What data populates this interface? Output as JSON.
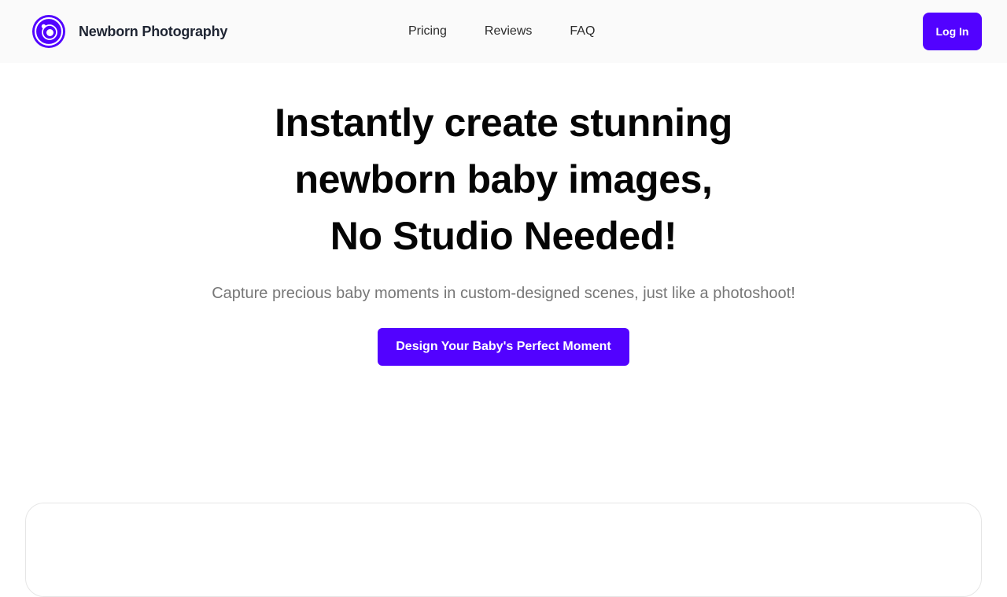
{
  "header": {
    "brand_name": "Newborn Photography",
    "logo_icon": "camera-lens-logo",
    "nav": [
      {
        "label": "Pricing"
      },
      {
        "label": "Reviews"
      },
      {
        "label": "FAQ"
      }
    ],
    "login_label": "Log In"
  },
  "hero": {
    "title_lines": [
      "Instantly create stunning",
      "newborn baby images,",
      "No Studio Needed!"
    ],
    "subtitle": "Capture precious baby moments in custom-designed scenes, just like a photoshoot!",
    "cta_label": "Design Your Baby's Perfect Moment"
  },
  "colors": {
    "accent": "#5202ff",
    "header_bg": "#fafafa",
    "subtitle_text": "#777777",
    "panel_border": "#e6e6e6"
  }
}
